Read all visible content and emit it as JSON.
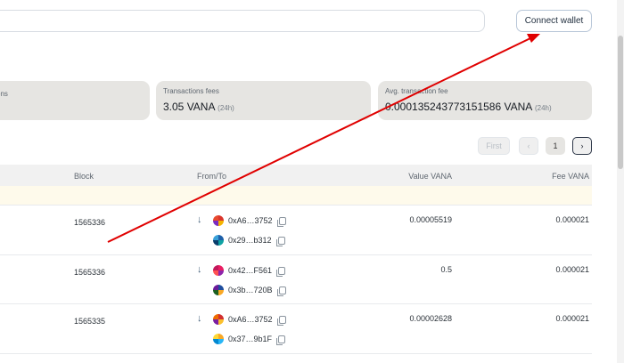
{
  "header": {
    "search_placeholder": "",
    "connect_label": "Connect wallet"
  },
  "stats": [
    {
      "label": "ons",
      "value": "",
      "suffix": ""
    },
    {
      "label": "Transactions fees",
      "value": "3.05 VANA",
      "suffix": "(24h)"
    },
    {
      "label": "Avg. transaction fee",
      "value": "0.000135243773151586 VANA",
      "suffix": "(24h)"
    }
  ],
  "pagination": {
    "first": "First",
    "prev": "‹",
    "current": "1",
    "next": "›"
  },
  "table": {
    "columns": [
      "Block",
      "From/To",
      "Value VANA",
      "Fee VANA"
    ],
    "rows": [
      {
        "block": "1565336",
        "from": "0xA6…3752",
        "to": "0x29…b312",
        "value": "0.00005519",
        "fee": "0.000021"
      },
      {
        "block": "1565336",
        "from": "0x42…F561",
        "to": "0x3b…720B",
        "value": "0.5",
        "fee": "0.000021"
      },
      {
        "block": "1565335",
        "from": "0xA6…3752",
        "to": "0x37…9b1F",
        "value": "0.00002628",
        "fee": "0.000021"
      }
    ]
  },
  "icons": {
    "direction": "arrow-down-icon",
    "copy": "copy-icon",
    "next": "chevron-right-icon",
    "prev": "chevron-left-icon"
  },
  "colors": {
    "annotation_arrow": "#e00000",
    "stat_bg": "#e6e5e2",
    "notice_bg": "#fefaeb"
  }
}
